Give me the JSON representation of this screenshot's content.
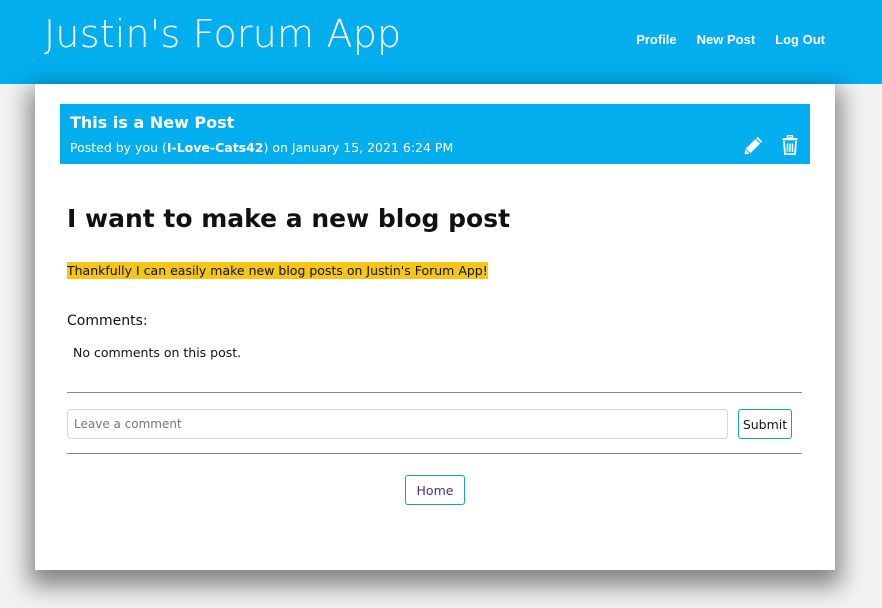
{
  "navbar": {
    "brand": "Justin's Forum App",
    "links": [
      {
        "label": "Profile"
      },
      {
        "label": "New Post"
      },
      {
        "label": "Log Out"
      }
    ]
  },
  "post": {
    "title": "This is a New Post",
    "meta_prefix": "Posted by you (",
    "author": "I-Love-Cats42",
    "meta_suffix": ") on January 15, 2021 6:24 PM",
    "heading": "I want to make a new blog post",
    "body": "Thankfully I can easily make new blog posts on Justin's Forum App!",
    "edit_icon": "pencil-icon",
    "delete_icon": "trash-icon"
  },
  "comments": {
    "label": "Comments:",
    "empty_text": "No comments on this post.",
    "input_placeholder": "Leave a comment",
    "input_value": "",
    "submit_label": "Submit"
  },
  "footer": {
    "home_label": "Home"
  },
  "colors": {
    "primary": "#03aeee",
    "highlight": "#f5c518",
    "button_border": "#17a2b8"
  }
}
